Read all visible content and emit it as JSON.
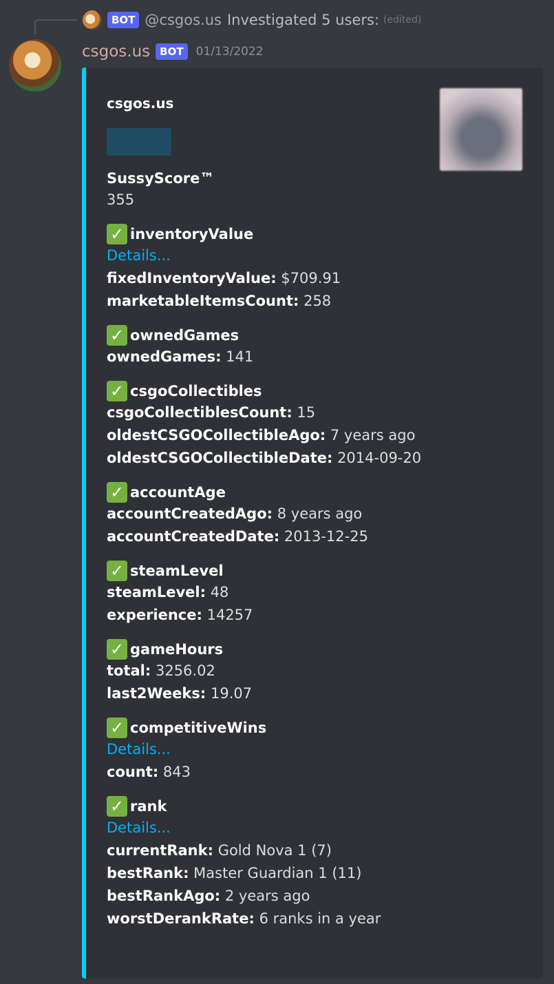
{
  "reply": {
    "bot_tag": "BOT",
    "user": "@csgos.us",
    "text": "Investigated 5 users:",
    "edited": "(edited)"
  },
  "message": {
    "username": "csgos.us",
    "bot_tag": "BOT",
    "timestamp": "01/13/2022"
  },
  "embed": {
    "accent_color": "#00d1ff",
    "title": "csgos.us",
    "score_label": "SussyScore™",
    "score_value": "355",
    "sections": [
      {
        "name": "inventoryValue",
        "details": "Details...",
        "lines": [
          {
            "k": "fixedInventoryValue:",
            "v": "$709.91"
          },
          {
            "k": "marketableItemsCount:",
            "v": "258"
          }
        ]
      },
      {
        "name": "ownedGames",
        "details": "",
        "lines": [
          {
            "k": "ownedGames:",
            "v": "141"
          }
        ]
      },
      {
        "name": "csgoCollectibles",
        "details": "",
        "lines": [
          {
            "k": "csgoCollectiblesCount:",
            "v": "15"
          },
          {
            "k": "oldestCSGOCollectibleAgo:",
            "v": "7 years ago"
          },
          {
            "k": "oldestCSGOCollectibleDate:",
            "v": "2014-09-20"
          }
        ]
      },
      {
        "name": "accountAge",
        "details": "",
        "lines": [
          {
            "k": "accountCreatedAgo:",
            "v": "8 years ago"
          },
          {
            "k": "accountCreatedDate:",
            "v": "2013-12-25"
          }
        ]
      },
      {
        "name": "steamLevel",
        "details": "",
        "lines": [
          {
            "k": "steamLevel:",
            "v": "48"
          },
          {
            "k": "experience:",
            "v": "14257"
          }
        ]
      },
      {
        "name": "gameHours",
        "details": "",
        "lines": [
          {
            "k": "total:",
            "v": "3256.02"
          },
          {
            "k": "last2Weeks:",
            "v": "19.07"
          }
        ]
      },
      {
        "name": "competitiveWins",
        "details": "Details...",
        "lines": [
          {
            "k": "count:",
            "v": "843"
          }
        ]
      },
      {
        "name": "rank",
        "details": "Details...",
        "lines": [
          {
            "k": "currentRank:",
            "v": "Gold Nova 1 (7)"
          },
          {
            "k": "bestRank:",
            "v": "Master Guardian 1 (11)"
          },
          {
            "k": "bestRankAgo:",
            "v": "2 years ago"
          },
          {
            "k": "worstDerankRate:",
            "v": "6 ranks in a year"
          }
        ]
      }
    ],
    "check_glyph": "✓"
  }
}
